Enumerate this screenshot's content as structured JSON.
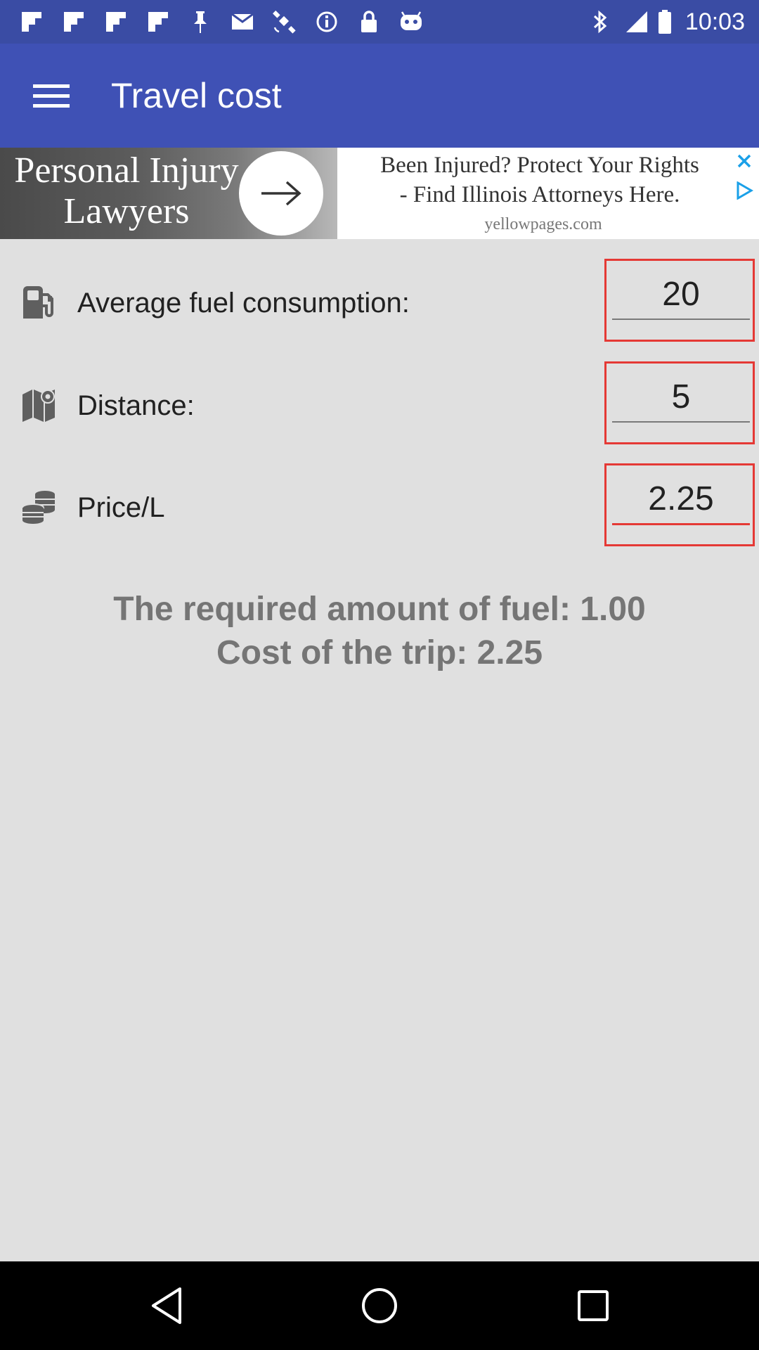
{
  "status_bar": {
    "time": "10:03",
    "left_icons": [
      "flipboard-icon",
      "flipboard-icon",
      "flipboard-icon",
      "flipboard-icon",
      "pin-icon",
      "email-icon",
      "satellite-icon",
      "info-icon",
      "lock-icon",
      "android-icon"
    ],
    "right_icons": [
      "bluetooth-icon",
      "signal-icon",
      "battery-icon"
    ]
  },
  "app_bar": {
    "title": "Travel cost",
    "menu_icon": "hamburger-menu-icon",
    "color": "#3f51b5"
  },
  "ad": {
    "image_text": "Personal Injury\nLawyers",
    "headline": "Been Injured? Protect Your Rights\n- Find Illinois Attorneys Here.",
    "domain": "yellowpages.com"
  },
  "form": {
    "rows": [
      {
        "icon": "fuel-pump-icon",
        "label": "Average fuel consumption:",
        "value": "20"
      },
      {
        "icon": "map-icon",
        "label": "Distance:",
        "value": "5"
      },
      {
        "icon": "coins-icon",
        "label": "Price/L",
        "value": "2.25"
      }
    ]
  },
  "results": {
    "fuel_line": "The required amount of fuel: 1.00",
    "cost_line": "Cost of the trip: 2.25"
  },
  "nav_bar": {
    "buttons": [
      "back-icon",
      "home-icon",
      "recents-icon"
    ]
  },
  "colors": {
    "status_bar": "#3a4ca4",
    "accent_error": "#e53935",
    "background": "#e0e0e0"
  }
}
